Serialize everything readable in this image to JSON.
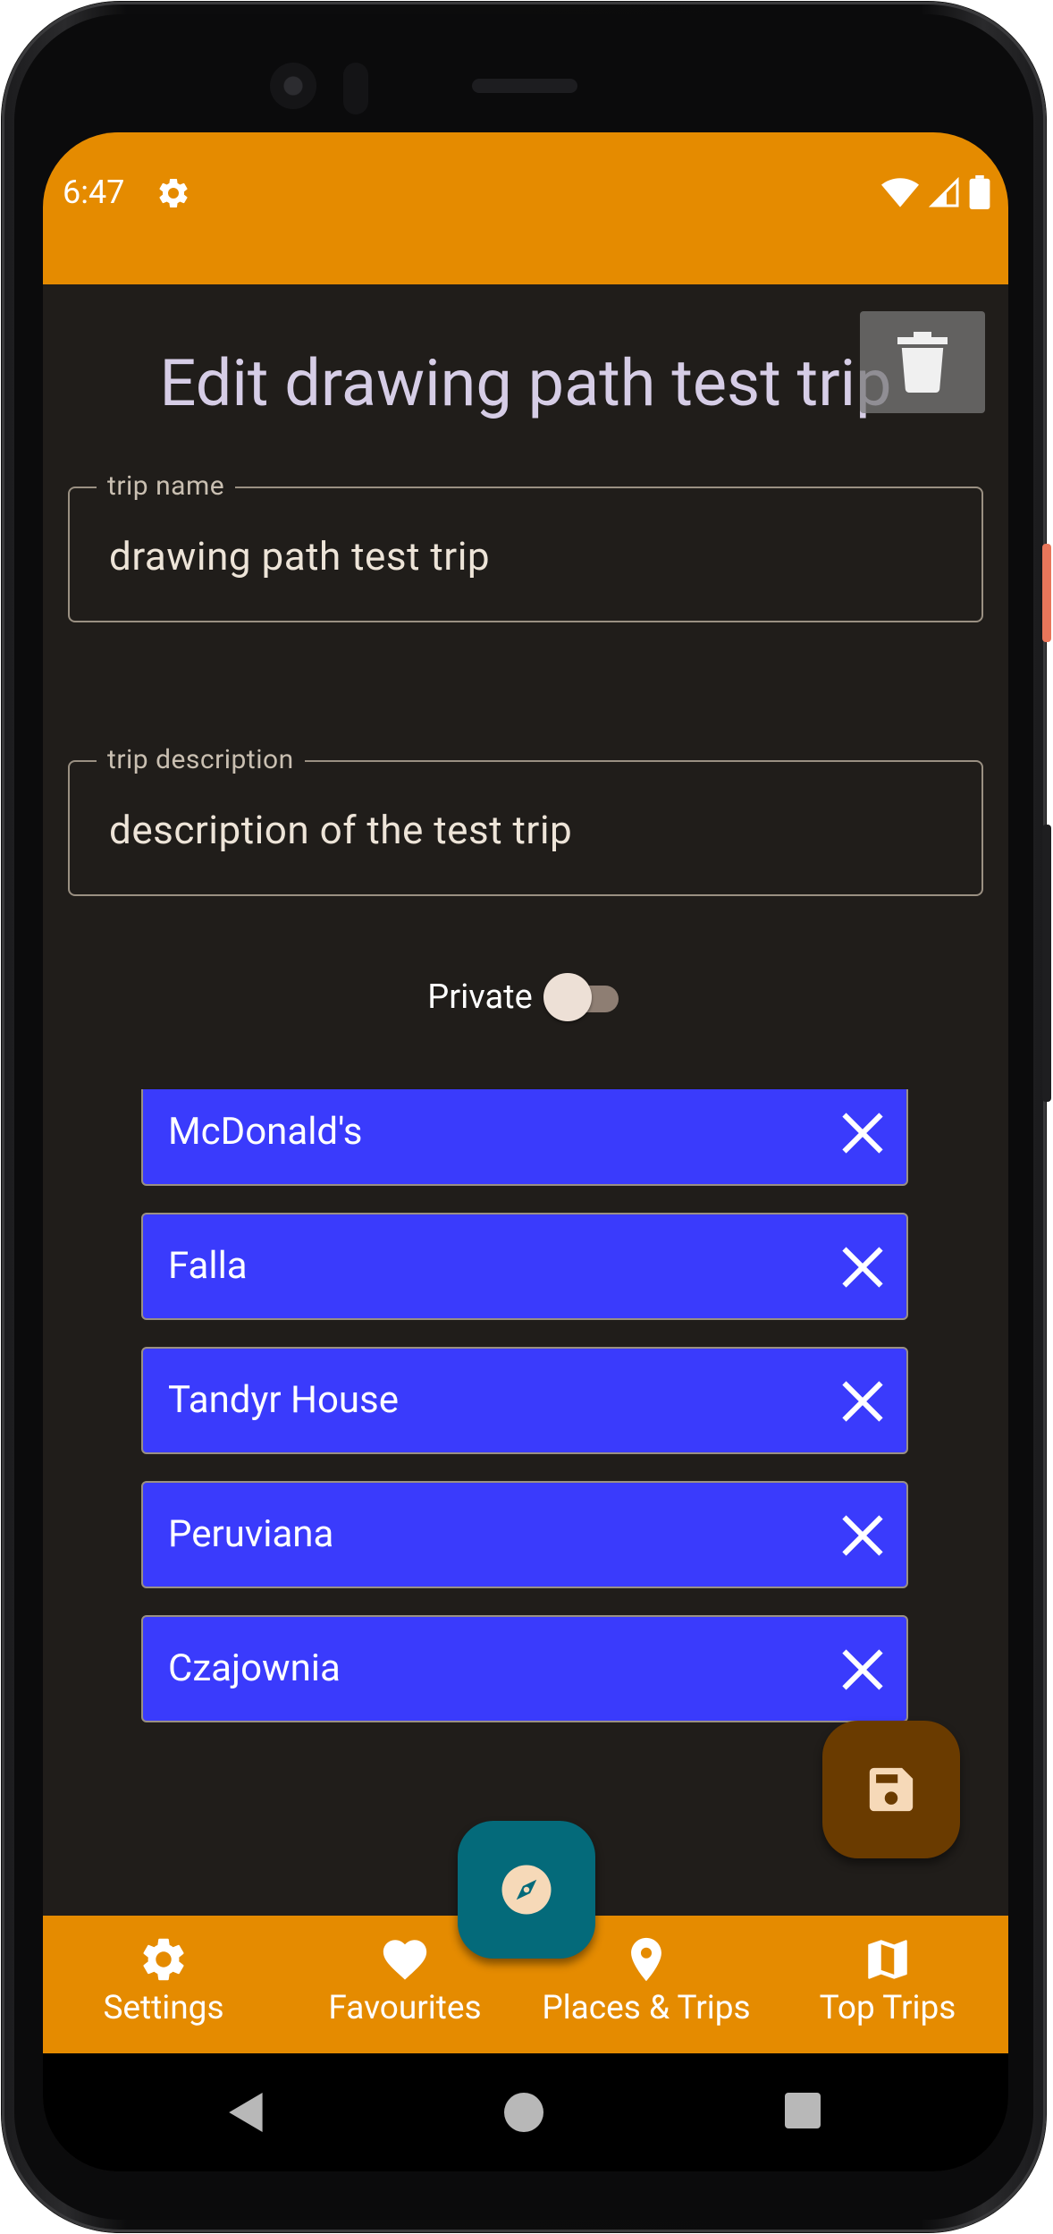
{
  "status_bar": {
    "time": "6:47",
    "icons": [
      "gear-icon",
      "wifi-icon",
      "cell-signal-icon",
      "battery-icon"
    ]
  },
  "header": {
    "title": "Edit drawing path test trip",
    "delete_icon": "trash-icon"
  },
  "form": {
    "trip_name": {
      "label": "trip name",
      "value": "drawing path test trip"
    },
    "trip_description": {
      "label": "trip description",
      "value": "description of the test trip"
    },
    "private": {
      "label": "Private",
      "checked": false
    }
  },
  "places": [
    {
      "name": "McDonald's"
    },
    {
      "name": "Falla"
    },
    {
      "name": "Tandyr House"
    },
    {
      "name": "Peruviana"
    },
    {
      "name": "Czajownia"
    }
  ],
  "fabs": {
    "save_icon": "floppy-disk-icon",
    "compass_icon": "compass-icon"
  },
  "bottom_nav": {
    "items": [
      {
        "label": "Settings",
        "icon": "gear-icon"
      },
      {
        "label": "Favourites",
        "icon": "heart-icon"
      },
      {
        "label": "Places & Trips",
        "icon": "map-pin-icon"
      },
      {
        "label": "Top Trips",
        "icon": "map-icon"
      }
    ]
  },
  "colors": {
    "accent": "#e58b00",
    "background": "#201d1a",
    "place_item": "#3a3bfc",
    "save_fab": "#6a3b00",
    "compass_fab": "#046a7a"
  }
}
